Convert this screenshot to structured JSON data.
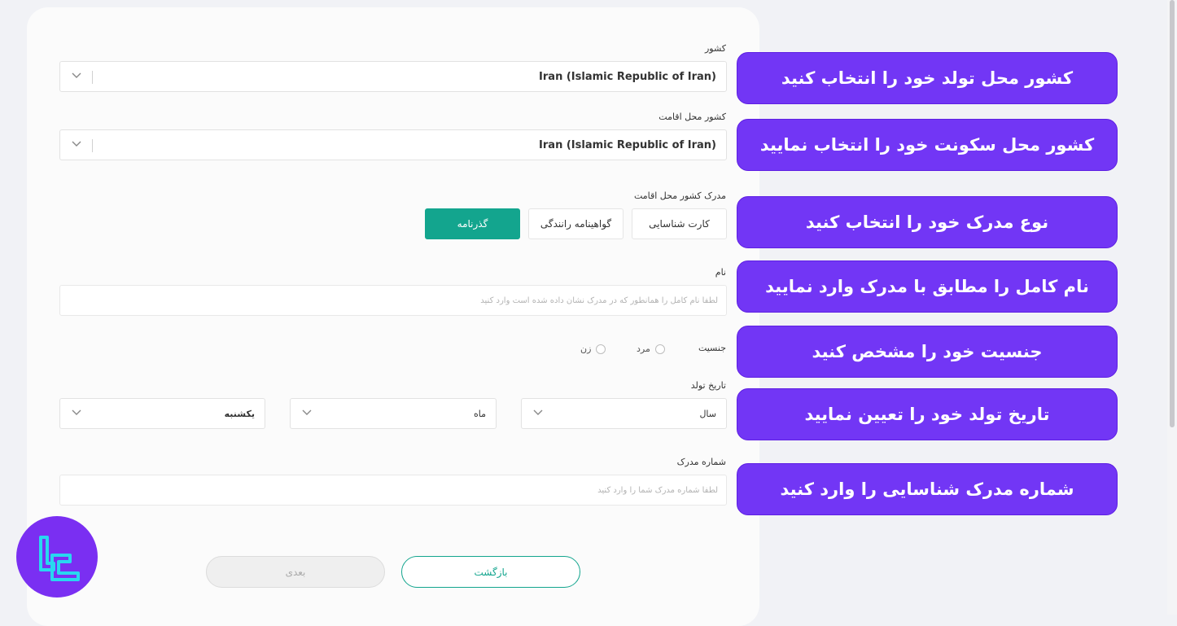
{
  "form": {
    "country_label": "کشور",
    "country_value": "Iran (Islamic Republic of Iran)",
    "residence_label": "کشور محل اقامت",
    "residence_value": "Iran (Islamic Republic of Iran)",
    "document_label": "مدرک کشور محل اقامت",
    "document_options": [
      "کارت شناسایی",
      "گواهینامه رانندگی",
      "گذرنامه"
    ],
    "document_selected": "گذرنامه",
    "name_label": "نام",
    "name_placeholder": "لطفاً نام کامل را همانطور که در مدرک نشان داده شده است وارد کنید",
    "gender_label": "جنسیت",
    "gender_options": [
      "مرد",
      "زن"
    ],
    "birth_label": "تاریخ تولد",
    "birth_year": "سال",
    "birth_month": "ماه",
    "birth_day": "یکشنبه",
    "doc_number_label": "شماره مدرک",
    "doc_number_placeholder": "لطفاً شماره مدرک شما را وارد کنید",
    "back_label": "بازگشت",
    "next_label": "بعدی"
  },
  "callouts": [
    "کشور محل تولد خود را انتخاب کنید",
    "کشور محل سکونت خود را انتخاب نمایید",
    "نوع مدرک خود را انتخاب کنید",
    "نام کامل را مطابق با مدرک وارد نمایید",
    "جنسیت خود را مشخص کنید",
    "تاریخ تولد خود را تعیین نمایید",
    "شماره مدرک شناسایی را وارد کنید"
  ],
  "icons": {
    "dropdown": "chevron-down-icon",
    "logo": "brand-logo-icon"
  },
  "colors": {
    "primary": "#13a58e",
    "callout": "#7236f5",
    "logo_bg": "#7a2ff2",
    "logo_stroke": "#28d7f0"
  }
}
